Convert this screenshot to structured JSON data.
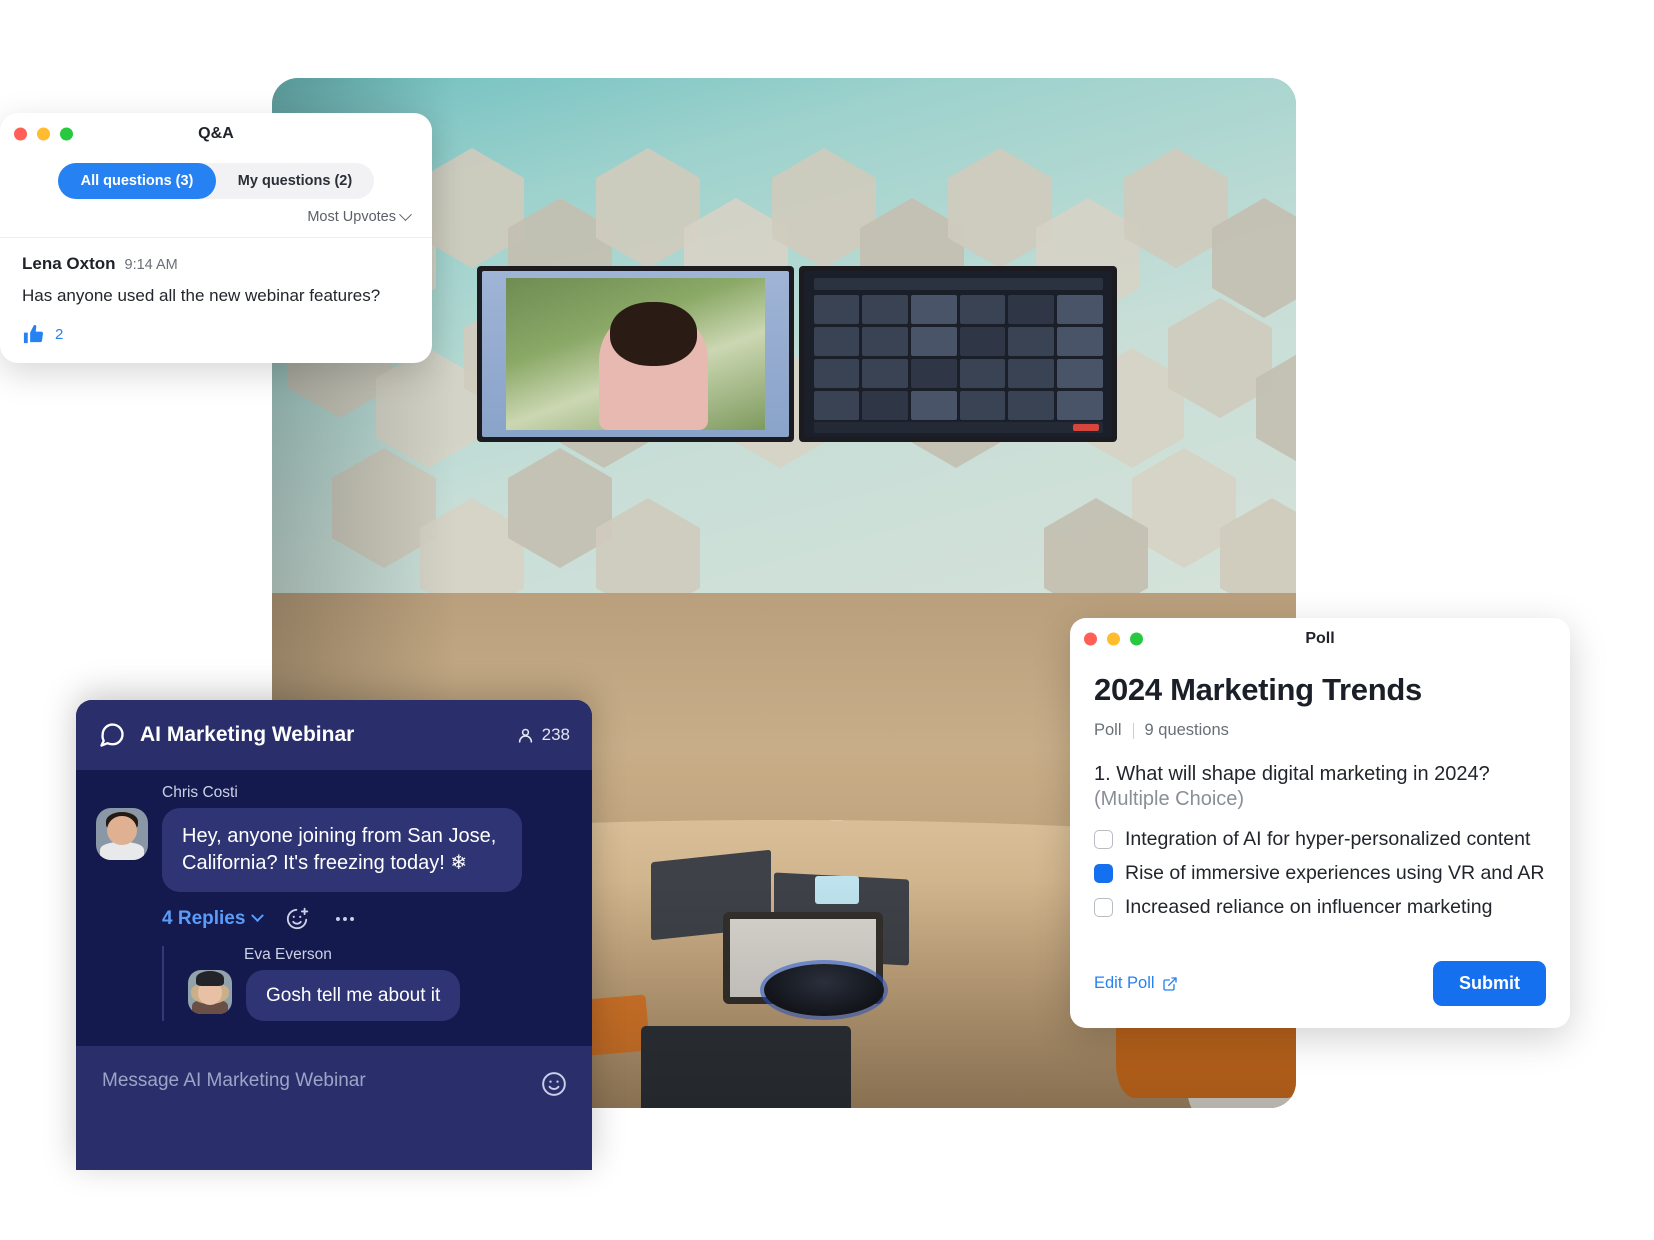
{
  "qa_window": {
    "titlebar_title": "Q&A",
    "traffic_lights": [
      "close",
      "minimize",
      "maximize"
    ],
    "tabs": [
      {
        "label": "All questions (3)",
        "active": true
      },
      {
        "label": "My questions (2)",
        "active": false
      }
    ],
    "sort": {
      "label": "Most Upvotes"
    },
    "question": {
      "author": "Lena Oxton",
      "time": "9:14 AM",
      "text": "Has anyone used all the new webinar features?",
      "upvotes": "2"
    }
  },
  "chat_window": {
    "title": "AI Marketing Webinar",
    "participants": "238",
    "messages": [
      {
        "author": "Chris Costi",
        "text": "Hey, anyone joining from San Jose, California? It's freezing today! ❄",
        "replies_label": "4 Replies"
      }
    ],
    "thread": [
      {
        "author": "Eva Everson",
        "text": "Gosh tell me about it"
      }
    ],
    "composer_placeholder": "Message AI Marketing Webinar"
  },
  "poll_window": {
    "titlebar_title": "Poll",
    "heading": "2024 Marketing Trends",
    "meta_type": "Poll",
    "meta_count": "9 questions",
    "question_number_text": "1. What will shape digital marketing in 2024?",
    "question_type": "(Multiple Choice)",
    "options": [
      {
        "label": "Integration of AI for hyper-personalized content",
        "checked": false
      },
      {
        "label": "Rise of immersive experiences using VR and AR",
        "checked": true
      },
      {
        "label": "Increased reliance on influencer marketing",
        "checked": false
      }
    ],
    "edit_link": "Edit Poll",
    "submit_label": "Submit"
  },
  "colors": {
    "accent_blue": "#1570ef",
    "link_blue": "#2681f2",
    "chat_dark": "#141a4d",
    "chat_header": "#2a2f6b",
    "bubble": "#2f3574"
  }
}
